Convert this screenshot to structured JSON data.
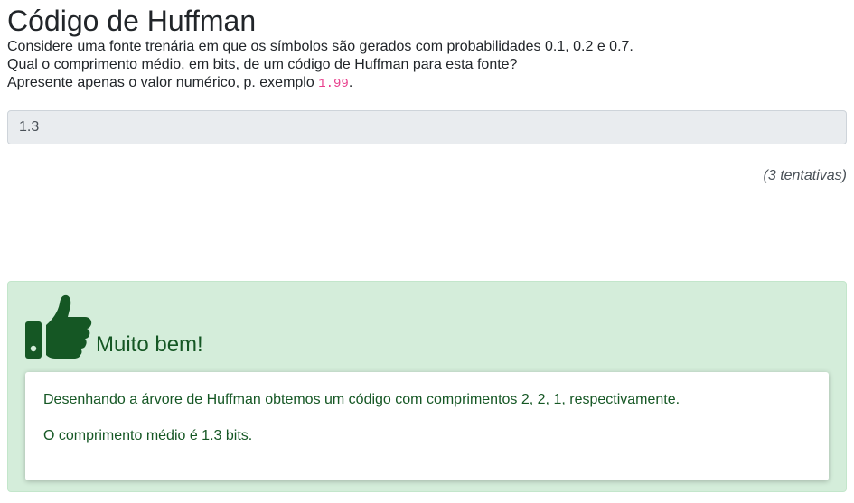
{
  "question": {
    "title": "Código de Huffman",
    "paragraph1": "Considere uma fonte trenária em que os símbolos são gerados com probabilidades 0.1, 0.2 e 0.7.",
    "paragraph2": "Qual o comprimento médio, em bits, de um código de Huffman para esta fonte?",
    "paragraph3_prefix": "Apresente apenas o valor numérico, p. exemplo ",
    "paragraph3_example": "1.99",
    "paragraph3_suffix": "."
  },
  "answer": {
    "value": "1.3"
  },
  "attempts": {
    "label": "(3 tentativas)"
  },
  "feedback": {
    "icon": "thumbs-up-icon",
    "title": "Muito bem!",
    "line1": "Desenhando a árvore de Huffman obtemos um código com comprimentos 2, 2, 1, respectivamente.",
    "line2": "O comprimento médio é 1.3 bits.",
    "colors": {
      "background": "#d4edda",
      "text": "#155724"
    }
  }
}
